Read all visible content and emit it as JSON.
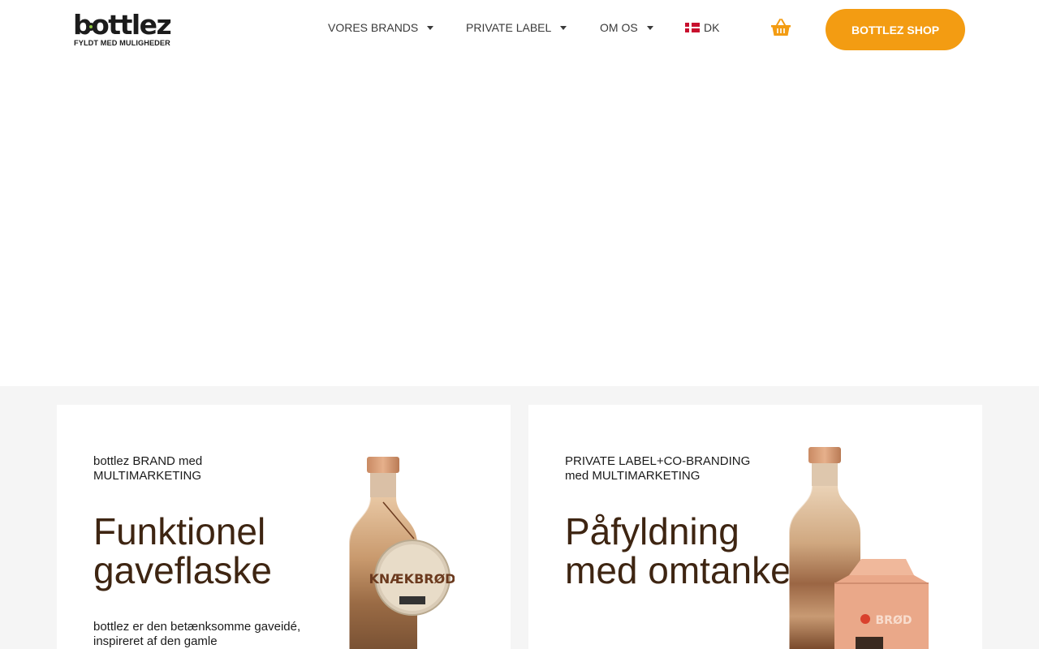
{
  "header": {
    "logo": {
      "word": "bottlez",
      "tagline": "FYLDT MED MULIGHEDER"
    },
    "nav": [
      {
        "label": "VORES BRANDS",
        "has_dropdown": true
      },
      {
        "label": "PRIVATE LABEL",
        "has_dropdown": true
      },
      {
        "label": "OM OS",
        "has_dropdown": true
      }
    ],
    "language": {
      "code": "DK",
      "flag": "denmark-flag"
    },
    "cart_icon": "basket-icon",
    "shop_button": "BOTTLEZ SHOP"
  },
  "cards": [
    {
      "eyebrow": "bottlez BRAND med MULTIMARKETING",
      "title": "Funktionel gaveflaske",
      "text": "bottlez er den betænksomme gaveidé, inspireret af den gamle",
      "product_tag": "KNÆKBRØD"
    },
    {
      "eyebrow": "PRIVATE LABEL+CO-BRANDING med MULTIMARKETING",
      "title": "Påfyldning med omtanke",
      "box_label": "BRØD"
    }
  ],
  "colors": {
    "accent": "#f39c12",
    "title_brown": "#3e2512",
    "section_bg": "#f5f5f5",
    "nav_text": "#3a3a3a"
  }
}
